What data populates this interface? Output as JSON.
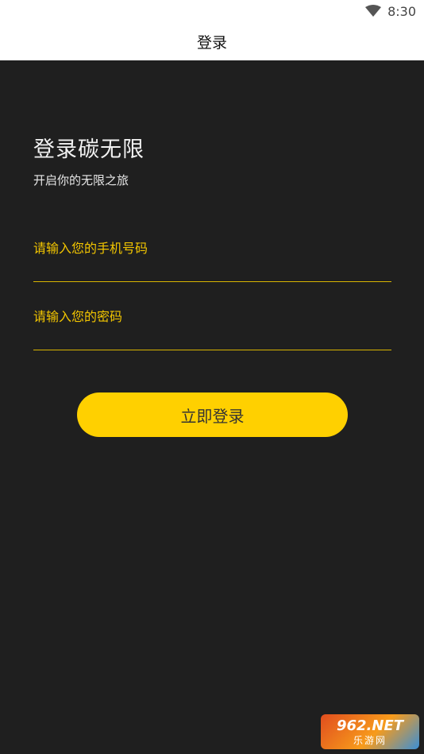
{
  "status_bar": {
    "time": "8:30",
    "wifi_icon": "wifi-icon"
  },
  "app_bar": {
    "title": "登录"
  },
  "login": {
    "headline": "登录碳无限",
    "subtitle": "开启你的无限之旅",
    "phone_placeholder": "请输入您的手机号码",
    "password_placeholder": "请输入您的密码",
    "submit_label": "立即登录"
  },
  "watermark": {
    "top": "962.NET",
    "bottom": "乐游网"
  },
  "colors": {
    "accent": "#ffd000",
    "background": "#1f1f1f",
    "app_bar": "#ffffff"
  }
}
